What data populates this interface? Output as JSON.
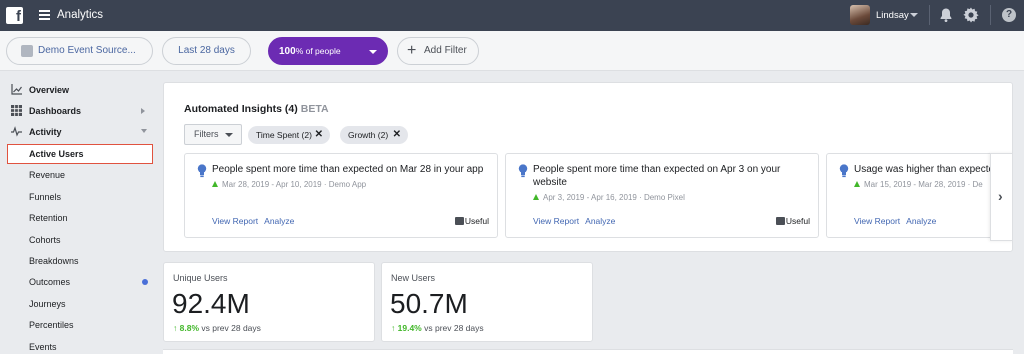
{
  "topbar": {
    "logo": "f",
    "app_title": "Analytics",
    "user_name": "Lindsay",
    "icons": [
      "hamburger-icon",
      "bell-icon",
      "gear-icon",
      "help-icon"
    ],
    "help_glyph": "?"
  },
  "filterbar": {
    "source": "Demo Event Source...",
    "date_range": "Last 28 days",
    "people_percent": "100",
    "people_suffix": "% of people",
    "add_filter": "Add Filter",
    "accent_color": "#6c2bb3"
  },
  "sidebar": {
    "sections": [
      {
        "label": "Overview",
        "icon": "chart-icon"
      },
      {
        "label": "Dashboards",
        "icon": "grid-icon"
      },
      {
        "label": "Activity",
        "icon": "pulse-icon"
      }
    ],
    "items": [
      {
        "label": "Active Users"
      },
      {
        "label": "Revenue"
      },
      {
        "label": "Funnels"
      },
      {
        "label": "Retention"
      },
      {
        "label": "Cohorts"
      },
      {
        "label": "Breakdowns"
      },
      {
        "label": "Outcomes"
      },
      {
        "label": "Journeys"
      },
      {
        "label": "Percentiles"
      },
      {
        "label": "Events"
      }
    ]
  },
  "insights": {
    "title": "Automated Insights (4)",
    "beta": "BETA",
    "filters_label": "Filters",
    "chips": [
      {
        "label": "Time Spent (2)",
        "close": "✕"
      },
      {
        "label": "Growth (2)",
        "close": "✕"
      }
    ],
    "cards": [
      {
        "headline": "People spent more time than expected on Mar 28 in your app",
        "meta": "Mar 28, 2019 - Apr 10, 2019 · Demo App",
        "view_report": "View Report",
        "analyze": "Analyze",
        "useful": "Useful"
      },
      {
        "headline": "People spent more time than expected on Apr 3 on your website",
        "meta": "Apr 3, 2019 - Apr 16, 2019 · Demo Pixel",
        "view_report": "View Report",
        "analyze": "Analyze",
        "useful": "Useful"
      },
      {
        "headline": "Usage was higher than expecte",
        "meta": "Mar 15, 2019 - Mar 28, 2019 · De",
        "view_report": "View Report",
        "analyze": "Analyze"
      }
    ],
    "next_glyph": "›"
  },
  "stats": [
    {
      "label": "Unique Users",
      "value": "92.4M",
      "delta": "8.8%",
      "delta_suffix": "vs prev 28 days",
      "arrow": "↑"
    },
    {
      "label": "New Users",
      "value": "50.7M",
      "delta": "19.4%",
      "delta_suffix": "vs prev 28 days",
      "arrow": "↑"
    }
  ]
}
